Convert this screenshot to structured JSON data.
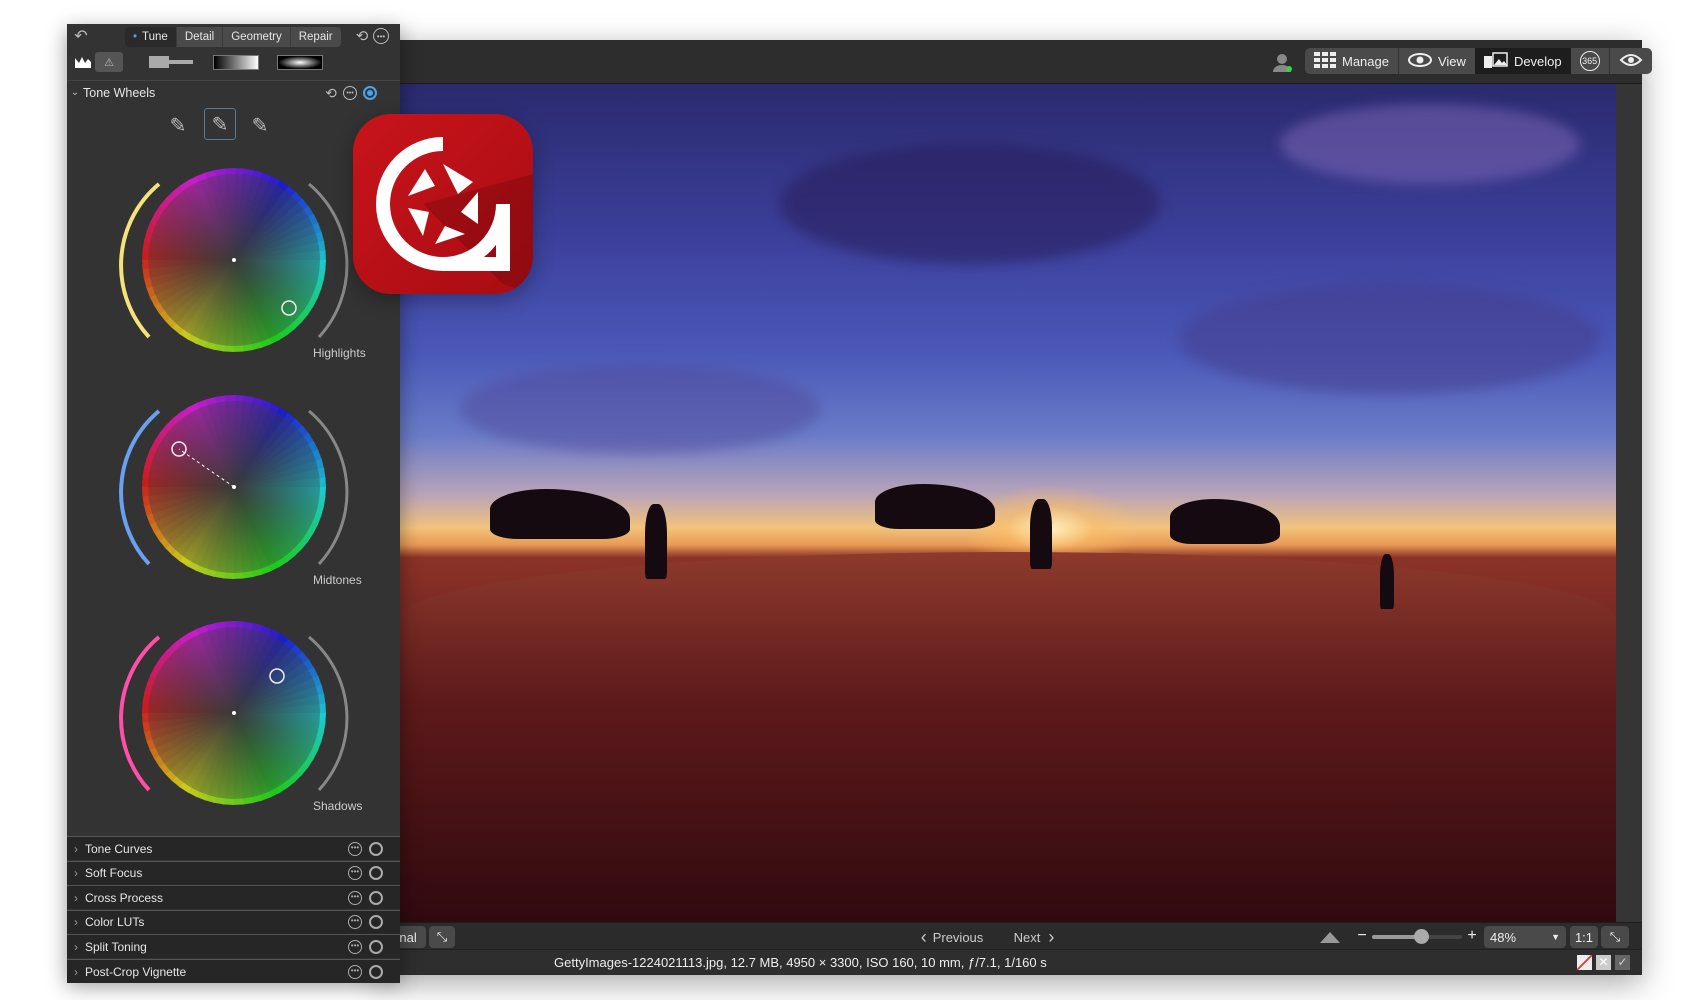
{
  "header": {
    "manage": "Manage",
    "view": "View",
    "develop": "Develop",
    "badge_365": "365"
  },
  "panel": {
    "tabs": [
      {
        "label": "Tune",
        "active": true
      },
      {
        "label": "Detail"
      },
      {
        "label": "Geometry"
      },
      {
        "label": "Repair"
      }
    ],
    "section_title": "Tone Wheels",
    "wheels": [
      {
        "label": "Highlights"
      },
      {
        "label": "Midtones"
      },
      {
        "label": "Shadows"
      }
    ],
    "rows": [
      {
        "label": "Tone Curves"
      },
      {
        "label": "Soft Focus"
      },
      {
        "label": "Cross Process"
      },
      {
        "label": "Color LUTs"
      },
      {
        "label": "Split Toning"
      },
      {
        "label": "Post-Crop Vignette"
      }
    ]
  },
  "bottom": {
    "original": "ginal",
    "previous": "Previous",
    "next": "Next",
    "zoom": "48%",
    "one_to_one": "1:1"
  },
  "status": {
    "file_info": "GettyImages-1224021113.jpg, 12.7 MB, 4950 × 3300, ISO 160, 10 mm, ƒ/7.1, 1/160 s"
  },
  "colors": {
    "accent": "#4aa3e8",
    "logo_red": "#c8141b",
    "online": "#3ecf4a"
  }
}
